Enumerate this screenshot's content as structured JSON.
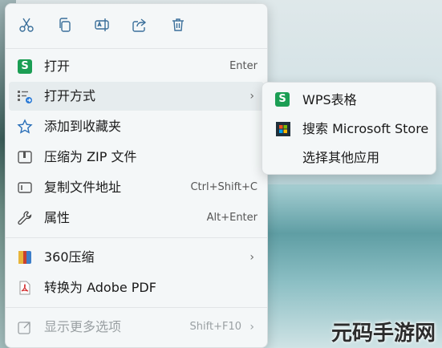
{
  "menu": {
    "items": [
      {
        "label": "打开",
        "shortcut": "Enter"
      },
      {
        "label": "打开方式",
        "shortcut": ""
      },
      {
        "label": "添加到收藏夹",
        "shortcut": ""
      },
      {
        "label": "压缩为 ZIP 文件",
        "shortcut": ""
      },
      {
        "label": "复制文件地址",
        "shortcut": "Ctrl+Shift+C"
      },
      {
        "label": "属性",
        "shortcut": "Alt+Enter"
      },
      {
        "label": "360压缩",
        "shortcut": ""
      },
      {
        "label": "转换为 Adobe PDF",
        "shortcut": ""
      },
      {
        "label": "显示更多选项",
        "shortcut": "Shift+F10"
      }
    ],
    "chevron": "›",
    "wps_glyph": "S"
  },
  "submenu": {
    "items": [
      {
        "label": "WPS表格"
      },
      {
        "label": "搜索 Microsoft Store"
      },
      {
        "label": "选择其他应用"
      }
    ]
  },
  "icons": {
    "accent": "#1b9e54",
    "toolbar": [
      "cut-icon",
      "copy-icon",
      "rename-icon",
      "share-icon",
      "delete-icon"
    ]
  },
  "watermark": "元码手游网"
}
